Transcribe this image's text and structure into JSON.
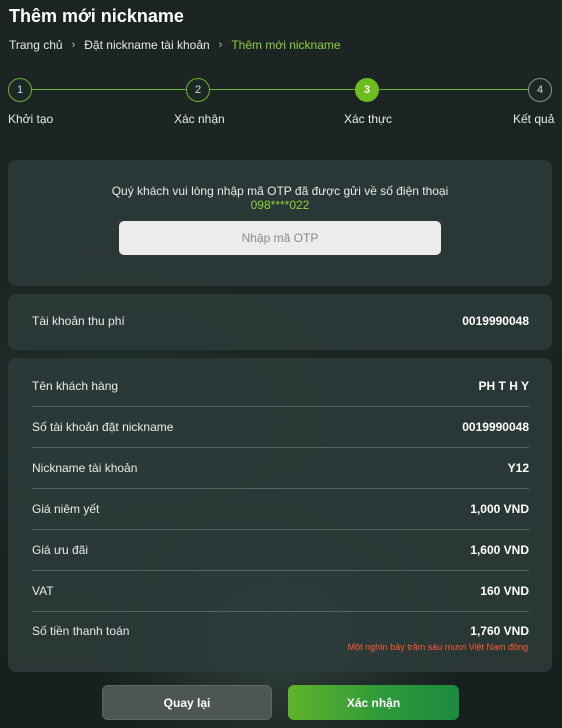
{
  "page": {
    "title": "Thêm mới nickname"
  },
  "breadcrumb": {
    "items": [
      "Trang chủ",
      "Đặt nickname tài khoản"
    ],
    "current": "Thêm mới nickname",
    "separator": "›"
  },
  "stepper": {
    "steps": [
      {
        "number": "1",
        "label": "Khởi tạo",
        "state": "done"
      },
      {
        "number": "2",
        "label": "Xác nhận",
        "state": "done"
      },
      {
        "number": "3",
        "label": "Xác thực",
        "state": "active"
      },
      {
        "number": "4",
        "label": "Kết quả",
        "state": "todo"
      }
    ]
  },
  "otp": {
    "message": "Quý khách vui lòng nhập mã OTP đã được gửi về số điện thoại",
    "phone": "098****022",
    "placeholder": "Nhập mã OTP"
  },
  "fee_account": {
    "label": "Tài khoản thu phí",
    "value": "0019990048"
  },
  "details": {
    "rows": [
      {
        "label": "Tên khách hàng",
        "value": "PH T H Y"
      },
      {
        "label": "Số tài khoản đặt nickname",
        "value": "0019990048"
      },
      {
        "label": "Nickname tài khoản",
        "value": "Y12"
      },
      {
        "label": "Giá niêm yết",
        "value": "1,000 VND"
      },
      {
        "label": "Giá ưu đãi",
        "value": "1,600 VND"
      },
      {
        "label": "VAT",
        "value": "160 VND"
      },
      {
        "label": "Số tiền thanh toán",
        "value": "1,760 VND"
      }
    ],
    "amount_in_words": "Một nghìn bảy trăm sáu mươi Việt Nam đồng"
  },
  "buttons": {
    "back": "Quay lại",
    "confirm": "Xác nhận"
  },
  "colors": {
    "accent": "#6dbd1f",
    "accent_text": "#8ed13c",
    "warning": "#ff5a36"
  }
}
